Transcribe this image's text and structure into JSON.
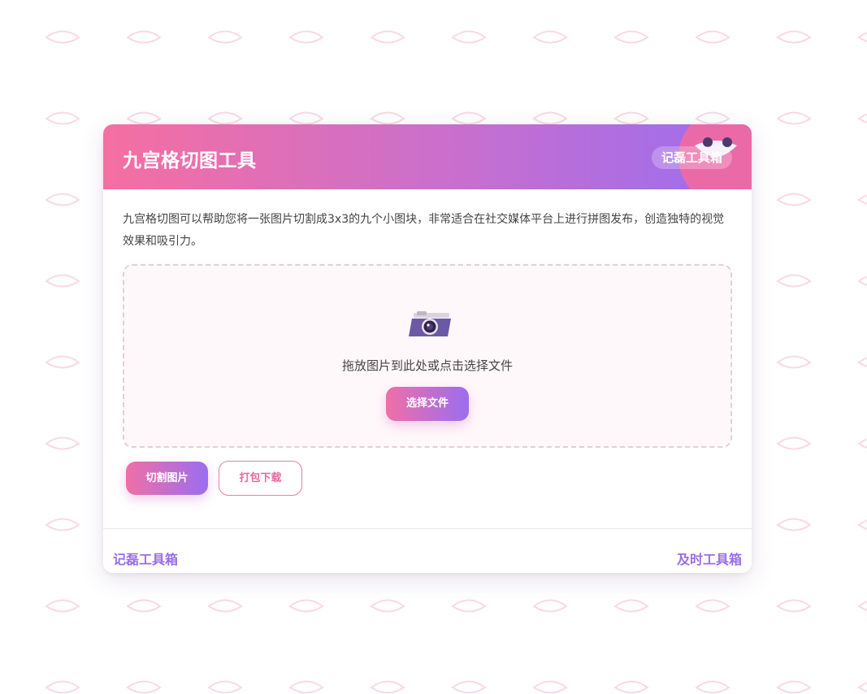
{
  "header": {
    "title": "九宫格切图工具",
    "badge": "记磊工具箱"
  },
  "description": "九宫格切图可以帮助您将一张图片切割成3x3的九个小图块，非常适合在社交媒体平台上进行拼图发布，创造独特的视觉效果和吸引力。",
  "dropzone": {
    "icon": "camera-icon",
    "text": "拖放图片到此处或点击选择文件",
    "select_label": "选择文件"
  },
  "actions": {
    "cut_label": "切割图片",
    "download_label": "打包下载"
  },
  "footer": {
    "left_link": "记磊工具箱",
    "right_link": "及时工具箱"
  },
  "colors": {
    "gradient_start": "#f56fa1",
    "gradient_end": "#9a6df0",
    "link": "#9a6de8",
    "pattern": "#f9d9e4"
  }
}
